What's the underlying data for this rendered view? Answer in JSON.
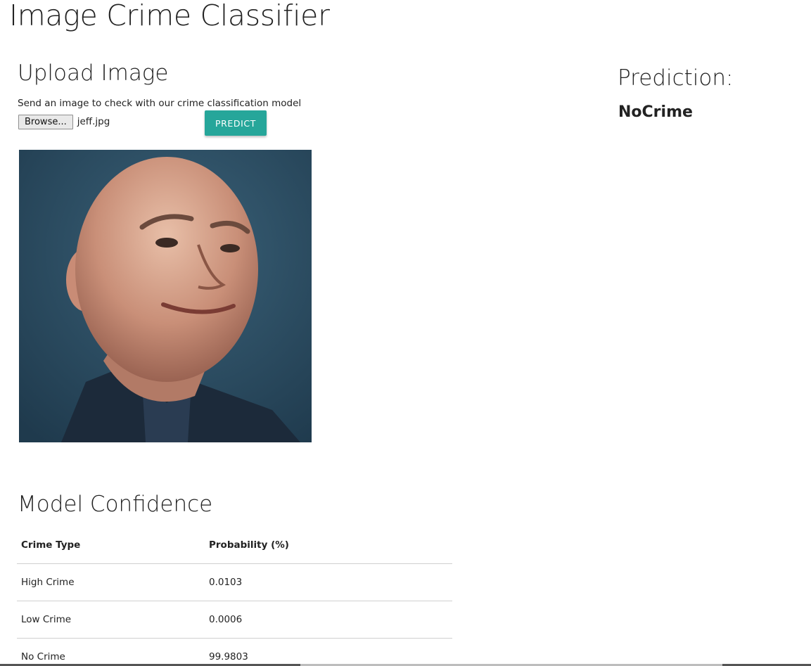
{
  "app": {
    "title": "Image Crime Classifier"
  },
  "upload": {
    "title": "Upload Image",
    "description": "Send an image to check with our crime classification model",
    "browse_label": "Browse...",
    "file_name": "jeff.jpg",
    "predict_label": "PREDICT"
  },
  "prediction": {
    "title": "Prediction:",
    "value": "NoCrime"
  },
  "confidence": {
    "title": "Model Confidence",
    "headers": [
      "Crime Type",
      "Probability (%)"
    ],
    "rows": [
      {
        "type": "High Crime",
        "probability": "0.0103"
      },
      {
        "type": "Low Crime",
        "probability": "0.0006"
      },
      {
        "type": "No Crime",
        "probability": "99.9803"
      }
    ]
  },
  "colors": {
    "accent": "#26a69a",
    "text": "#222222",
    "photo_background": "#2b4a5f"
  }
}
